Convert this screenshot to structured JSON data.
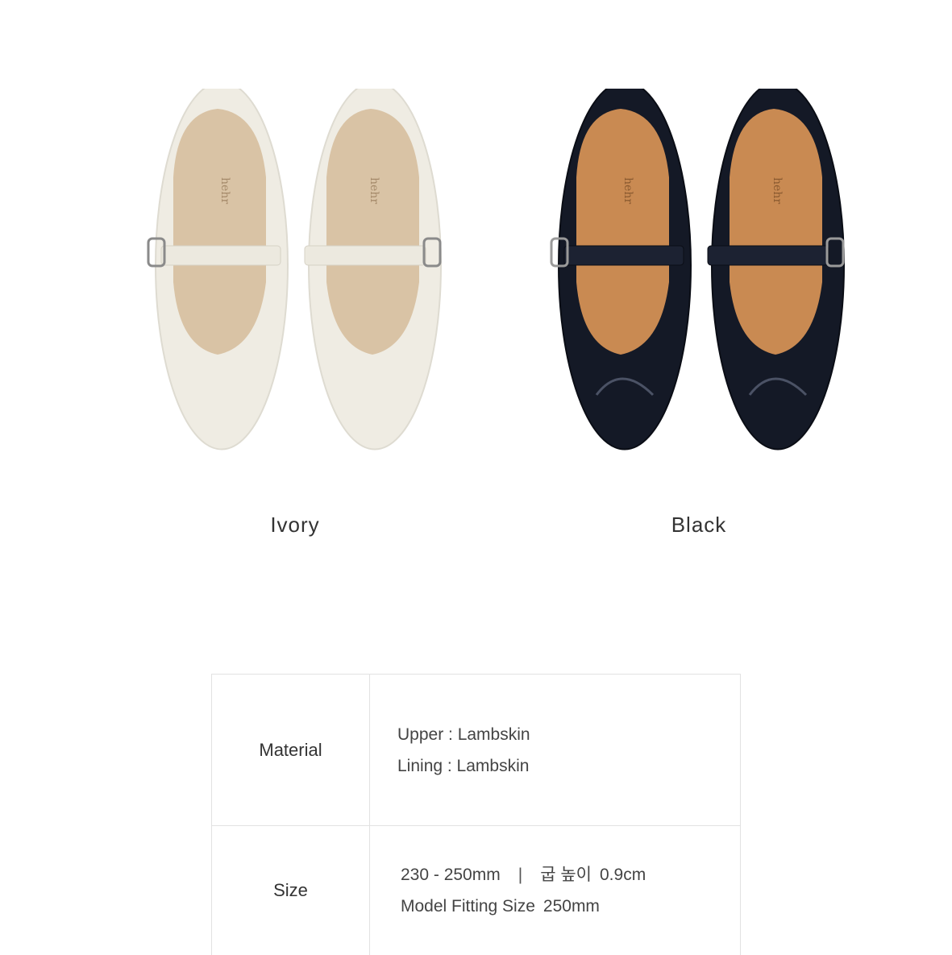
{
  "products": [
    {
      "color_name": "Ivory",
      "swatch": "#efece3",
      "lining": "#d9c3a5",
      "brand_mark": "hehr"
    },
    {
      "color_name": "Black",
      "swatch": "#141926",
      "lining": "#c98a52",
      "brand_mark": "hehr"
    }
  ],
  "specs": {
    "material_label": "Material",
    "material_upper": "Upper : Lambskin",
    "material_lining": "Lining : Lambskin",
    "size_label": "Size",
    "size_range": "230 - 250mm",
    "size_separator": "|",
    "heel_label": "굽 높이",
    "heel_value": "0.9cm",
    "fitting_label": "Model Fitting Size",
    "fitting_value": "250mm"
  }
}
